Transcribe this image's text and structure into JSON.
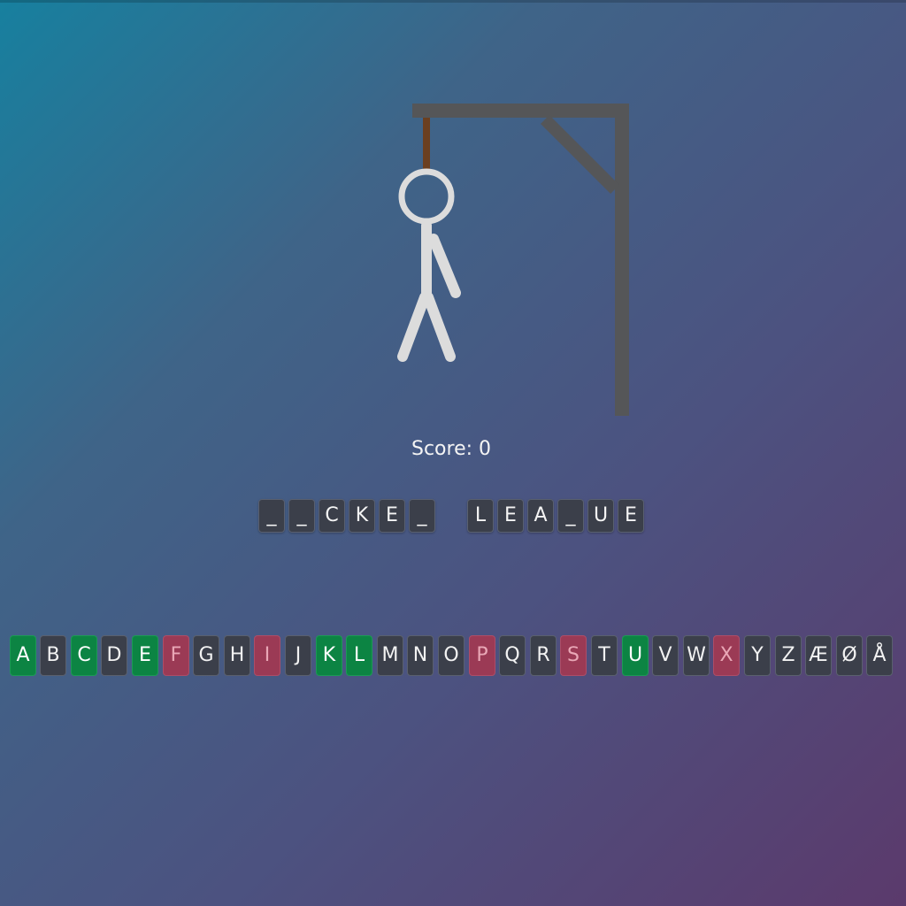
{
  "game": {
    "score_text": "Score: 0",
    "colors": {
      "gallows": "#555658",
      "rope": "#6b3f20",
      "figure": "#dcdcdc",
      "tile_bg": "#3b3f4a",
      "correct_bg": "#0c8443",
      "wrong_bg": "#9b3a55"
    },
    "gallows": {
      "parts": [
        "base-beam",
        "top-beam",
        "support-brace",
        "rope"
      ]
    },
    "figure": {
      "parts": [
        "head",
        "body",
        "right-arm",
        "left-leg",
        "right-leg"
      ]
    }
  },
  "word": [
    [
      "_",
      "_",
      "C",
      "K",
      "E",
      "_"
    ],
    [
      "L",
      "E",
      "A",
      "_",
      "U",
      "E"
    ]
  ],
  "keyboard": {
    "keys": [
      {
        "letter": "A",
        "state": "correct"
      },
      {
        "letter": "B",
        "state": "unused"
      },
      {
        "letter": "C",
        "state": "correct"
      },
      {
        "letter": "D",
        "state": "unused"
      },
      {
        "letter": "E",
        "state": "correct"
      },
      {
        "letter": "F",
        "state": "wrong"
      },
      {
        "letter": "G",
        "state": "unused"
      },
      {
        "letter": "H",
        "state": "unused"
      },
      {
        "letter": "I",
        "state": "wrong"
      },
      {
        "letter": "J",
        "state": "unused"
      },
      {
        "letter": "K",
        "state": "correct"
      },
      {
        "letter": "L",
        "state": "correct"
      },
      {
        "letter": "M",
        "state": "unused"
      },
      {
        "letter": "N",
        "state": "unused"
      },
      {
        "letter": "O",
        "state": "unused"
      },
      {
        "letter": "P",
        "state": "wrong"
      },
      {
        "letter": "Q",
        "state": "unused"
      },
      {
        "letter": "R",
        "state": "unused"
      },
      {
        "letter": "S",
        "state": "wrong"
      },
      {
        "letter": "T",
        "state": "unused"
      },
      {
        "letter": "U",
        "state": "correct"
      },
      {
        "letter": "V",
        "state": "unused"
      },
      {
        "letter": "W",
        "state": "unused"
      },
      {
        "letter": "X",
        "state": "wrong"
      },
      {
        "letter": "Y",
        "state": "unused"
      },
      {
        "letter": "Z",
        "state": "unused"
      },
      {
        "letter": "Æ",
        "state": "unused"
      },
      {
        "letter": "Ø",
        "state": "unused"
      },
      {
        "letter": "Å",
        "state": "unused"
      }
    ]
  }
}
